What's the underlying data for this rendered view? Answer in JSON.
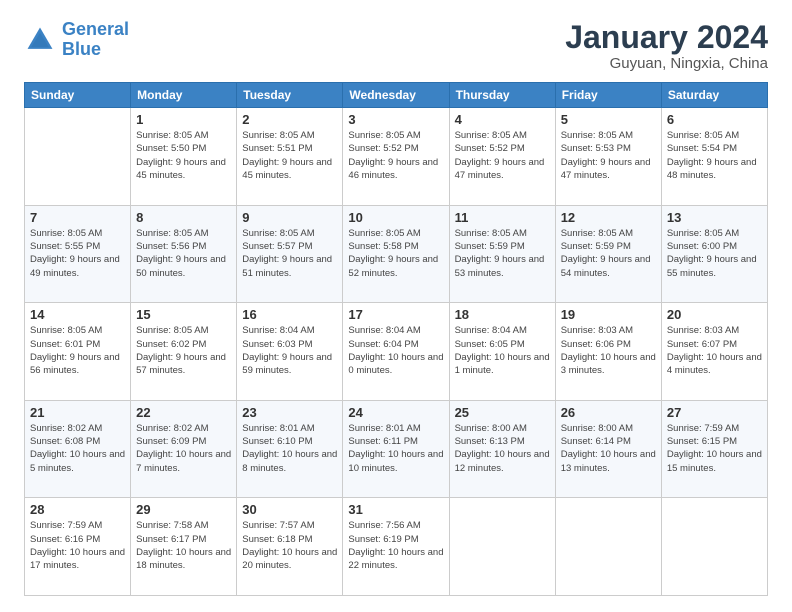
{
  "logo": {
    "name_line1": "General",
    "name_line2": "Blue"
  },
  "header": {
    "month_year": "January 2024",
    "location": "Guyuan, Ningxia, China"
  },
  "days_of_week": [
    "Sunday",
    "Monday",
    "Tuesday",
    "Wednesday",
    "Thursday",
    "Friday",
    "Saturday"
  ],
  "weeks": [
    [
      {
        "day": "",
        "sunrise": "",
        "sunset": "",
        "daylight": ""
      },
      {
        "day": "1",
        "sunrise": "Sunrise: 8:05 AM",
        "sunset": "Sunset: 5:50 PM",
        "daylight": "Daylight: 9 hours and 45 minutes."
      },
      {
        "day": "2",
        "sunrise": "Sunrise: 8:05 AM",
        "sunset": "Sunset: 5:51 PM",
        "daylight": "Daylight: 9 hours and 45 minutes."
      },
      {
        "day": "3",
        "sunrise": "Sunrise: 8:05 AM",
        "sunset": "Sunset: 5:52 PM",
        "daylight": "Daylight: 9 hours and 46 minutes."
      },
      {
        "day": "4",
        "sunrise": "Sunrise: 8:05 AM",
        "sunset": "Sunset: 5:52 PM",
        "daylight": "Daylight: 9 hours and 47 minutes."
      },
      {
        "day": "5",
        "sunrise": "Sunrise: 8:05 AM",
        "sunset": "Sunset: 5:53 PM",
        "daylight": "Daylight: 9 hours and 47 minutes."
      },
      {
        "day": "6",
        "sunrise": "Sunrise: 8:05 AM",
        "sunset": "Sunset: 5:54 PM",
        "daylight": "Daylight: 9 hours and 48 minutes."
      }
    ],
    [
      {
        "day": "7",
        "sunrise": "Sunrise: 8:05 AM",
        "sunset": "Sunset: 5:55 PM",
        "daylight": "Daylight: 9 hours and 49 minutes."
      },
      {
        "day": "8",
        "sunrise": "Sunrise: 8:05 AM",
        "sunset": "Sunset: 5:56 PM",
        "daylight": "Daylight: 9 hours and 50 minutes."
      },
      {
        "day": "9",
        "sunrise": "Sunrise: 8:05 AM",
        "sunset": "Sunset: 5:57 PM",
        "daylight": "Daylight: 9 hours and 51 minutes."
      },
      {
        "day": "10",
        "sunrise": "Sunrise: 8:05 AM",
        "sunset": "Sunset: 5:58 PM",
        "daylight": "Daylight: 9 hours and 52 minutes."
      },
      {
        "day": "11",
        "sunrise": "Sunrise: 8:05 AM",
        "sunset": "Sunset: 5:59 PM",
        "daylight": "Daylight: 9 hours and 53 minutes."
      },
      {
        "day": "12",
        "sunrise": "Sunrise: 8:05 AM",
        "sunset": "Sunset: 5:59 PM",
        "daylight": "Daylight: 9 hours and 54 minutes."
      },
      {
        "day": "13",
        "sunrise": "Sunrise: 8:05 AM",
        "sunset": "Sunset: 6:00 PM",
        "daylight": "Daylight: 9 hours and 55 minutes."
      }
    ],
    [
      {
        "day": "14",
        "sunrise": "Sunrise: 8:05 AM",
        "sunset": "Sunset: 6:01 PM",
        "daylight": "Daylight: 9 hours and 56 minutes."
      },
      {
        "day": "15",
        "sunrise": "Sunrise: 8:05 AM",
        "sunset": "Sunset: 6:02 PM",
        "daylight": "Daylight: 9 hours and 57 minutes."
      },
      {
        "day": "16",
        "sunrise": "Sunrise: 8:04 AM",
        "sunset": "Sunset: 6:03 PM",
        "daylight": "Daylight: 9 hours and 59 minutes."
      },
      {
        "day": "17",
        "sunrise": "Sunrise: 8:04 AM",
        "sunset": "Sunset: 6:04 PM",
        "daylight": "Daylight: 10 hours and 0 minutes."
      },
      {
        "day": "18",
        "sunrise": "Sunrise: 8:04 AM",
        "sunset": "Sunset: 6:05 PM",
        "daylight": "Daylight: 10 hours and 1 minute."
      },
      {
        "day": "19",
        "sunrise": "Sunrise: 8:03 AM",
        "sunset": "Sunset: 6:06 PM",
        "daylight": "Daylight: 10 hours and 3 minutes."
      },
      {
        "day": "20",
        "sunrise": "Sunrise: 8:03 AM",
        "sunset": "Sunset: 6:07 PM",
        "daylight": "Daylight: 10 hours and 4 minutes."
      }
    ],
    [
      {
        "day": "21",
        "sunrise": "Sunrise: 8:02 AM",
        "sunset": "Sunset: 6:08 PM",
        "daylight": "Daylight: 10 hours and 5 minutes."
      },
      {
        "day": "22",
        "sunrise": "Sunrise: 8:02 AM",
        "sunset": "Sunset: 6:09 PM",
        "daylight": "Daylight: 10 hours and 7 minutes."
      },
      {
        "day": "23",
        "sunrise": "Sunrise: 8:01 AM",
        "sunset": "Sunset: 6:10 PM",
        "daylight": "Daylight: 10 hours and 8 minutes."
      },
      {
        "day": "24",
        "sunrise": "Sunrise: 8:01 AM",
        "sunset": "Sunset: 6:11 PM",
        "daylight": "Daylight: 10 hours and 10 minutes."
      },
      {
        "day": "25",
        "sunrise": "Sunrise: 8:00 AM",
        "sunset": "Sunset: 6:13 PM",
        "daylight": "Daylight: 10 hours and 12 minutes."
      },
      {
        "day": "26",
        "sunrise": "Sunrise: 8:00 AM",
        "sunset": "Sunset: 6:14 PM",
        "daylight": "Daylight: 10 hours and 13 minutes."
      },
      {
        "day": "27",
        "sunrise": "Sunrise: 7:59 AM",
        "sunset": "Sunset: 6:15 PM",
        "daylight": "Daylight: 10 hours and 15 minutes."
      }
    ],
    [
      {
        "day": "28",
        "sunrise": "Sunrise: 7:59 AM",
        "sunset": "Sunset: 6:16 PM",
        "daylight": "Daylight: 10 hours and 17 minutes."
      },
      {
        "day": "29",
        "sunrise": "Sunrise: 7:58 AM",
        "sunset": "Sunset: 6:17 PM",
        "daylight": "Daylight: 10 hours and 18 minutes."
      },
      {
        "day": "30",
        "sunrise": "Sunrise: 7:57 AM",
        "sunset": "Sunset: 6:18 PM",
        "daylight": "Daylight: 10 hours and 20 minutes."
      },
      {
        "day": "31",
        "sunrise": "Sunrise: 7:56 AM",
        "sunset": "Sunset: 6:19 PM",
        "daylight": "Daylight: 10 hours and 22 minutes."
      },
      {
        "day": "",
        "sunrise": "",
        "sunset": "",
        "daylight": ""
      },
      {
        "day": "",
        "sunrise": "",
        "sunset": "",
        "daylight": ""
      },
      {
        "day": "",
        "sunrise": "",
        "sunset": "",
        "daylight": ""
      }
    ]
  ]
}
